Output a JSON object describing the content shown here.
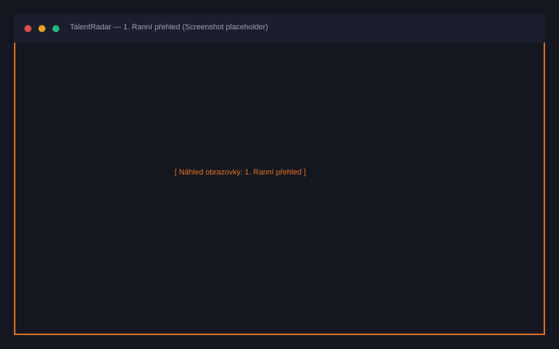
{
  "colors": {
    "background": "#141720",
    "titlebar": "#1b1f2d",
    "accent": "#e8711f",
    "title_text": "#9aa1b2",
    "dot_close": "#e04b4b",
    "dot_minimize": "#f0a21c",
    "dot_maximize": "#1fb87a"
  },
  "window": {
    "title": "TalentRadar — 1. Ranní přehled (Screenshot placeholder)",
    "controls": {
      "close_icon": "red-dot-icon",
      "minimize_icon": "yellow-dot-icon",
      "maximize_icon": "green-dot-icon"
    }
  },
  "main": {
    "placeholder_text": "[ Náhled obrazovky: 1. Ranní přehled ]"
  }
}
